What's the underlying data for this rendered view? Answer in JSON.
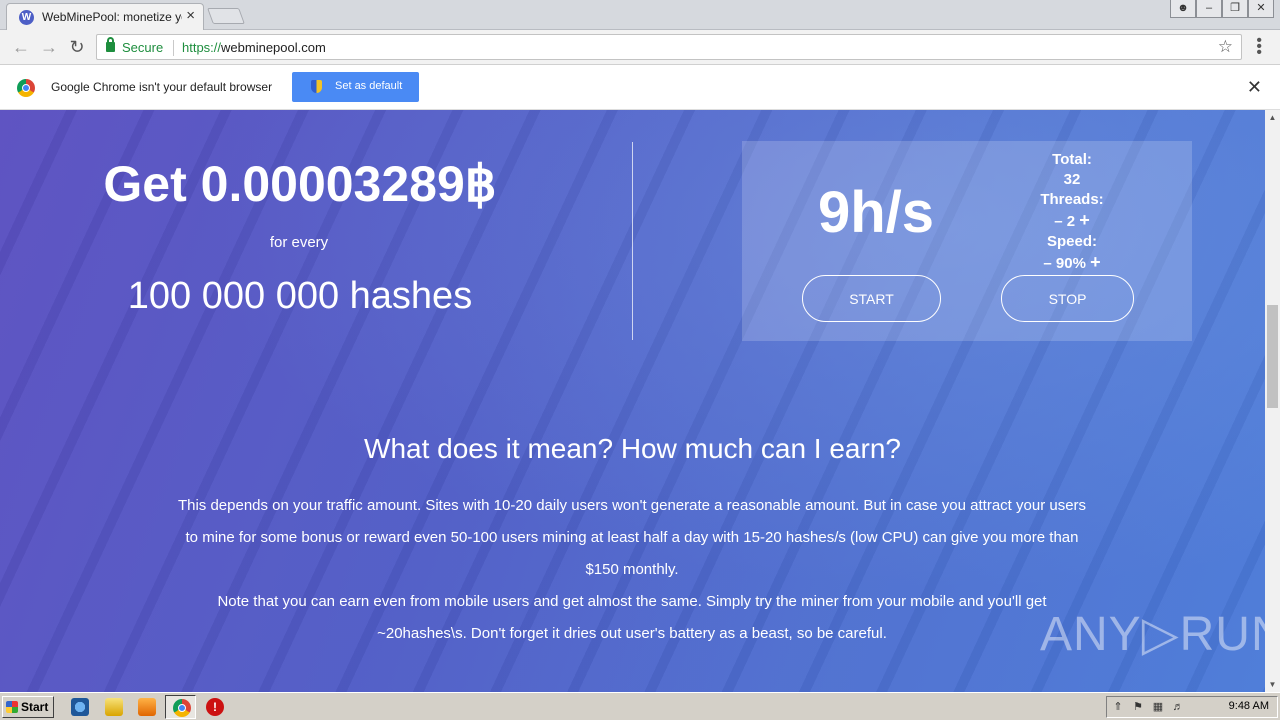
{
  "browser": {
    "tab_title": "WebMinePool: monetize you",
    "tab_favicon": "W",
    "secure_label": "Secure",
    "url_scheme": "https://",
    "url_host": "webminepool.com",
    "infobar_text": "Google Chrome isn't your default browser",
    "infobar_button": "Set as default"
  },
  "hero": {
    "reward": "Get 0.00003289฿",
    "for_every": "for every",
    "hashes": "100 000 000 hashes"
  },
  "miner": {
    "speed": "9h/s",
    "total_label": "Total:",
    "total_value": "32",
    "threads_label": "Threads:",
    "threads_minus": "–",
    "threads_value": "2",
    "threads_plus": "+",
    "speed_label": "Speed:",
    "speed_minus": "–",
    "speed_value": "90%",
    "speed_plus": "+",
    "start": "START",
    "stop": "STOP"
  },
  "info": {
    "heading": "What does it mean? How much can I earn?",
    "paragraph1": "This depends on your traffic amount. Sites with 10-20 daily users won't generate a reasonable amount. But in case you attract your users to mine for some bonus or reward even 50-100 users mining at least half a day with 15-20 hashes/s (low CPU) can give you more than $150 monthly.",
    "paragraph2": "Note that you can earn even from mobile users and get almost the same. Simply try the miner from your mobile and you'll get ~20hashes\\s. Don't forget it dries out user's battery as a beast, so be careful."
  },
  "watermark": "ANY▷RUN",
  "taskbar": {
    "start": "Start",
    "clock": "9:48 AM"
  },
  "colors": {
    "page_gradient_start": "#5a4fc0",
    "page_gradient_end": "#4a7ad8",
    "infobar_button": "#4a8af4",
    "secure_green": "#1e8e3e"
  }
}
